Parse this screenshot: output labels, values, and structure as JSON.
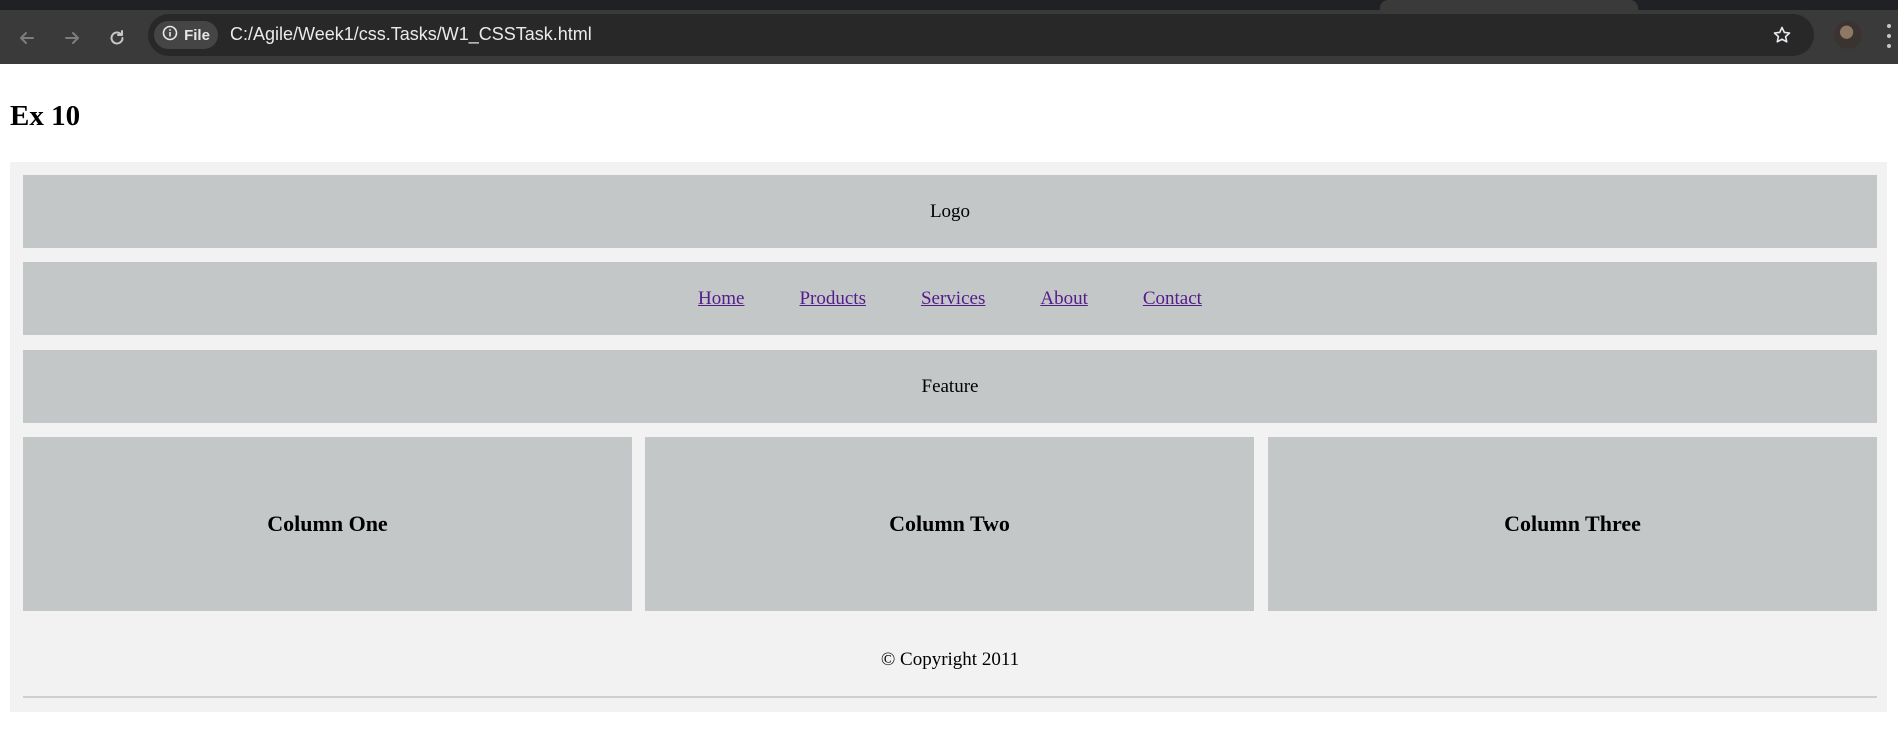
{
  "browser": {
    "site_chip_label": "File",
    "url": "C:/Agile/Week1/css.Tasks/W1_CSSTask.html",
    "icons": [
      "back-icon",
      "forward-icon",
      "reload-icon",
      "info-icon",
      "star-icon",
      "profile-avatar",
      "more-menu-icon"
    ]
  },
  "page": {
    "heading": "Ex 10",
    "logo_text": "Logo",
    "nav": [
      "Home",
      "Products",
      "Services",
      "About",
      "Contact"
    ],
    "feature_text": "Feature",
    "columns": [
      "Column One",
      "Column Two",
      "Column Three"
    ],
    "footer": "© Copyright 2011"
  },
  "colors": {
    "chrome_bg": "#3a3a3a",
    "omnibox_bg": "#282828",
    "wrapper_bg": "#f2f2f2",
    "block_bg": "#c4c7c8",
    "visited_link": "#551a8b"
  }
}
